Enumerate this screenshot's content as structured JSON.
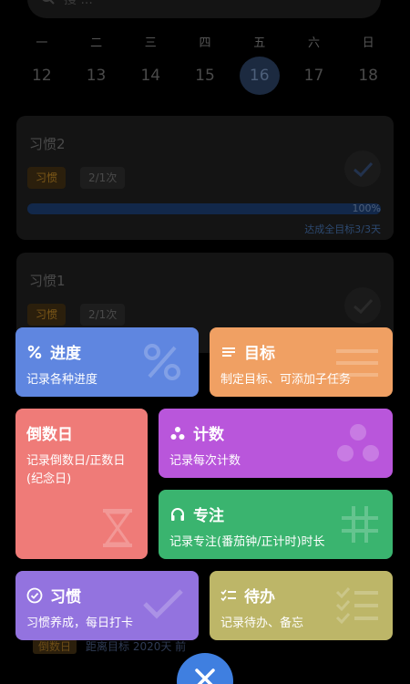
{
  "search": {
    "placeholder": "搜 ...",
    "icon": "search-icon"
  },
  "calendar": {
    "weekdays": [
      "一",
      "二",
      "三",
      "四",
      "五",
      "六",
      "日"
    ],
    "dates": [
      "12",
      "13",
      "14",
      "15",
      "16",
      "17",
      "18"
    ],
    "selected_date": "16"
  },
  "habits": [
    {
      "name": "习惯2",
      "type_tag": "习惯",
      "count_tag": "2/1次",
      "progress_fraction": 1.0,
      "progress_label": "100%",
      "note": "达成全目标3/3天"
    },
    {
      "name": "习惯1",
      "type_tag": "习惯",
      "count_tag": "2/1次"
    }
  ],
  "bottom_hint": {
    "tag": "倒数日",
    "text": "距离目标 2020天 前"
  },
  "menu": {
    "progress": {
      "title": "进度",
      "desc": "记录各种进度",
      "icon": "percent-icon",
      "color": "#5f86e0"
    },
    "goal": {
      "title": "目标",
      "desc": "制定目标、可添加子任务",
      "icon": "list-lines-icon",
      "color": "#f0a063"
    },
    "countdown": {
      "title": "倒数日",
      "desc": "记录倒数日/正数日(纪念日)",
      "icon": "hourglass-icon",
      "color": "#ef7b78"
    },
    "counter": {
      "title": "计数",
      "desc": "记录每次计数",
      "icon": "dots-icon",
      "color": "#b956db"
    },
    "focus": {
      "title": "专注",
      "desc": "记录专注(番茄钟/正计时)时长",
      "icon": "headphones-icon",
      "color": "#3ab46f"
    },
    "habit": {
      "title": "习惯",
      "desc": "习惯养成，每日打卡",
      "icon": "check-circle-icon",
      "color": "#9373df"
    },
    "todo": {
      "title": "待办",
      "desc": "记录待办、备忘",
      "icon": "checklist-icon",
      "color": "#bdb668"
    }
  },
  "close_button": {
    "icon": "close-icon",
    "color": "#3f7fe0"
  }
}
